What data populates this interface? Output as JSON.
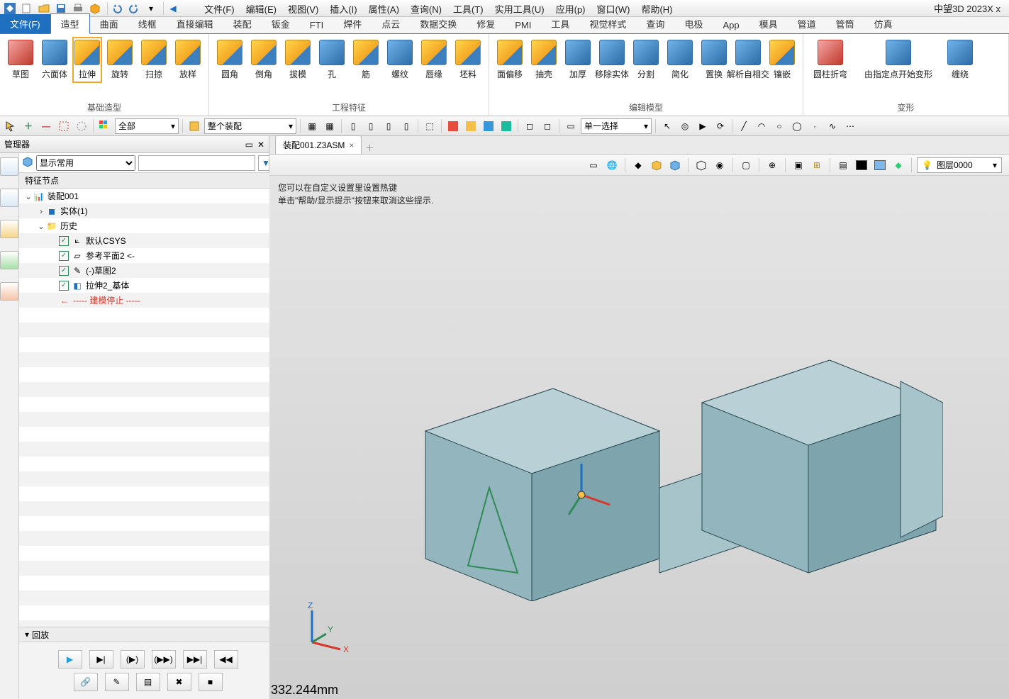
{
  "app_title": "中望3D 2023X x",
  "menu": [
    "文件(F)",
    "编辑(E)",
    "视图(V)",
    "插入(I)",
    "属性(A)",
    "查询(N)",
    "工具(T)",
    "实用工具(U)",
    "应用(p)",
    "窗口(W)",
    "帮助(H)"
  ],
  "tabs": {
    "file": "文件(F)",
    "items": [
      "造型",
      "曲面",
      "线框",
      "直接编辑",
      "装配",
      "钣金",
      "FTI",
      "焊件",
      "点云",
      "数据交换",
      "修复",
      "PMI",
      "工具",
      "视觉样式",
      "查询",
      "电极",
      "App",
      "模具",
      "管道",
      "管筒",
      "仿真"
    ],
    "active": "造型"
  },
  "ribbon": {
    "groups": [
      {
        "label": "基础造型",
        "items": [
          "草图",
          "六面体",
          "拉伸",
          "旋转",
          "扫掠",
          "放样"
        ],
        "highlight": "拉伸"
      },
      {
        "label": "工程特征",
        "items": [
          "圆角",
          "倒角",
          "拔模",
          "孔",
          "筋",
          "螺纹",
          "唇缘",
          "坯料"
        ]
      },
      {
        "label": "编辑模型",
        "items": [
          "面偏移",
          "抽壳",
          "加厚",
          "移除实体",
          "分割",
          "简化",
          "置换",
          "解析自相交",
          "镶嵌"
        ]
      },
      {
        "label": "变形",
        "items": [
          "圆柱折弯",
          "由指定点开始变形",
          "缠绕"
        ]
      }
    ]
  },
  "toolbar2": {
    "combo1": "全部",
    "combo2": "整个装配",
    "select_mode": "单一选择"
  },
  "manager": {
    "title": "管理器",
    "filter_label": "显示常用",
    "section": "特征节点",
    "tree": {
      "root": "装配001",
      "nodes": [
        {
          "label": "实体(1)",
          "icon": "cube"
        },
        {
          "label": "历史",
          "icon": "folder",
          "children": [
            {
              "label": "默认CSYS",
              "icon": "csys",
              "checked": true
            },
            {
              "label": "参考平面2 <-",
              "icon": "plane",
              "checked": true
            },
            {
              "label": "(-)草图2",
              "icon": "sketch",
              "checked": true
            },
            {
              "label": "拉伸2_基体",
              "icon": "extrude",
              "checked": true
            },
            {
              "label": "----- 建模停止 -----",
              "icon": "stop",
              "red": true
            }
          ]
        }
      ]
    },
    "playback": "回放"
  },
  "document": {
    "tab": "装配001.Z3ASM"
  },
  "view_toolbar": {
    "layer": "图层0000"
  },
  "viewport": {
    "hint1": "您可以在自定义设置里设置热键",
    "hint2": "单击\"帮助/显示提示\"按钮来取消这些提示.",
    "measurement": "332.244mm",
    "axes": {
      "x": "X",
      "y": "Y",
      "z": "Z"
    }
  }
}
